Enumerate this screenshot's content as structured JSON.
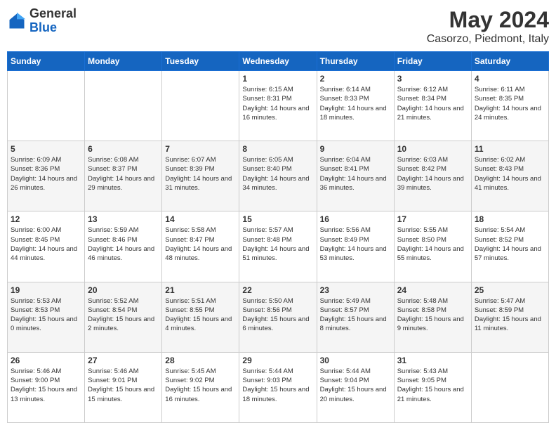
{
  "logo": {
    "general": "General",
    "blue": "Blue"
  },
  "header": {
    "month_year": "May 2024",
    "location": "Casorzo, Piedmont, Italy"
  },
  "weekdays": [
    "Sunday",
    "Monday",
    "Tuesday",
    "Wednesday",
    "Thursday",
    "Friday",
    "Saturday"
  ],
  "weeks": [
    [
      {
        "day": "",
        "sunrise": "",
        "sunset": "",
        "daylight": ""
      },
      {
        "day": "",
        "sunrise": "",
        "sunset": "",
        "daylight": ""
      },
      {
        "day": "",
        "sunrise": "",
        "sunset": "",
        "daylight": ""
      },
      {
        "day": "1",
        "sunrise": "Sunrise: 6:15 AM",
        "sunset": "Sunset: 8:31 PM",
        "daylight": "Daylight: 14 hours and 16 minutes."
      },
      {
        "day": "2",
        "sunrise": "Sunrise: 6:14 AM",
        "sunset": "Sunset: 8:33 PM",
        "daylight": "Daylight: 14 hours and 18 minutes."
      },
      {
        "day": "3",
        "sunrise": "Sunrise: 6:12 AM",
        "sunset": "Sunset: 8:34 PM",
        "daylight": "Daylight: 14 hours and 21 minutes."
      },
      {
        "day": "4",
        "sunrise": "Sunrise: 6:11 AM",
        "sunset": "Sunset: 8:35 PM",
        "daylight": "Daylight: 14 hours and 24 minutes."
      }
    ],
    [
      {
        "day": "5",
        "sunrise": "Sunrise: 6:09 AM",
        "sunset": "Sunset: 8:36 PM",
        "daylight": "Daylight: 14 hours and 26 minutes."
      },
      {
        "day": "6",
        "sunrise": "Sunrise: 6:08 AM",
        "sunset": "Sunset: 8:37 PM",
        "daylight": "Daylight: 14 hours and 29 minutes."
      },
      {
        "day": "7",
        "sunrise": "Sunrise: 6:07 AM",
        "sunset": "Sunset: 8:39 PM",
        "daylight": "Daylight: 14 hours and 31 minutes."
      },
      {
        "day": "8",
        "sunrise": "Sunrise: 6:05 AM",
        "sunset": "Sunset: 8:40 PM",
        "daylight": "Daylight: 14 hours and 34 minutes."
      },
      {
        "day": "9",
        "sunrise": "Sunrise: 6:04 AM",
        "sunset": "Sunset: 8:41 PM",
        "daylight": "Daylight: 14 hours and 36 minutes."
      },
      {
        "day": "10",
        "sunrise": "Sunrise: 6:03 AM",
        "sunset": "Sunset: 8:42 PM",
        "daylight": "Daylight: 14 hours and 39 minutes."
      },
      {
        "day": "11",
        "sunrise": "Sunrise: 6:02 AM",
        "sunset": "Sunset: 8:43 PM",
        "daylight": "Daylight: 14 hours and 41 minutes."
      }
    ],
    [
      {
        "day": "12",
        "sunrise": "Sunrise: 6:00 AM",
        "sunset": "Sunset: 8:45 PM",
        "daylight": "Daylight: 14 hours and 44 minutes."
      },
      {
        "day": "13",
        "sunrise": "Sunrise: 5:59 AM",
        "sunset": "Sunset: 8:46 PM",
        "daylight": "Daylight: 14 hours and 46 minutes."
      },
      {
        "day": "14",
        "sunrise": "Sunrise: 5:58 AM",
        "sunset": "Sunset: 8:47 PM",
        "daylight": "Daylight: 14 hours and 48 minutes."
      },
      {
        "day": "15",
        "sunrise": "Sunrise: 5:57 AM",
        "sunset": "Sunset: 8:48 PM",
        "daylight": "Daylight: 14 hours and 51 minutes."
      },
      {
        "day": "16",
        "sunrise": "Sunrise: 5:56 AM",
        "sunset": "Sunset: 8:49 PM",
        "daylight": "Daylight: 14 hours and 53 minutes."
      },
      {
        "day": "17",
        "sunrise": "Sunrise: 5:55 AM",
        "sunset": "Sunset: 8:50 PM",
        "daylight": "Daylight: 14 hours and 55 minutes."
      },
      {
        "day": "18",
        "sunrise": "Sunrise: 5:54 AM",
        "sunset": "Sunset: 8:52 PM",
        "daylight": "Daylight: 14 hours and 57 minutes."
      }
    ],
    [
      {
        "day": "19",
        "sunrise": "Sunrise: 5:53 AM",
        "sunset": "Sunset: 8:53 PM",
        "daylight": "Daylight: 15 hours and 0 minutes."
      },
      {
        "day": "20",
        "sunrise": "Sunrise: 5:52 AM",
        "sunset": "Sunset: 8:54 PM",
        "daylight": "Daylight: 15 hours and 2 minutes."
      },
      {
        "day": "21",
        "sunrise": "Sunrise: 5:51 AM",
        "sunset": "Sunset: 8:55 PM",
        "daylight": "Daylight: 15 hours and 4 minutes."
      },
      {
        "day": "22",
        "sunrise": "Sunrise: 5:50 AM",
        "sunset": "Sunset: 8:56 PM",
        "daylight": "Daylight: 15 hours and 6 minutes."
      },
      {
        "day": "23",
        "sunrise": "Sunrise: 5:49 AM",
        "sunset": "Sunset: 8:57 PM",
        "daylight": "Daylight: 15 hours and 8 minutes."
      },
      {
        "day": "24",
        "sunrise": "Sunrise: 5:48 AM",
        "sunset": "Sunset: 8:58 PM",
        "daylight": "Daylight: 15 hours and 9 minutes."
      },
      {
        "day": "25",
        "sunrise": "Sunrise: 5:47 AM",
        "sunset": "Sunset: 8:59 PM",
        "daylight": "Daylight: 15 hours and 11 minutes."
      }
    ],
    [
      {
        "day": "26",
        "sunrise": "Sunrise: 5:46 AM",
        "sunset": "Sunset: 9:00 PM",
        "daylight": "Daylight: 15 hours and 13 minutes."
      },
      {
        "day": "27",
        "sunrise": "Sunrise: 5:46 AM",
        "sunset": "Sunset: 9:01 PM",
        "daylight": "Daylight: 15 hours and 15 minutes."
      },
      {
        "day": "28",
        "sunrise": "Sunrise: 5:45 AM",
        "sunset": "Sunset: 9:02 PM",
        "daylight": "Daylight: 15 hours and 16 minutes."
      },
      {
        "day": "29",
        "sunrise": "Sunrise: 5:44 AM",
        "sunset": "Sunset: 9:03 PM",
        "daylight": "Daylight: 15 hours and 18 minutes."
      },
      {
        "day": "30",
        "sunrise": "Sunrise: 5:44 AM",
        "sunset": "Sunset: 9:04 PM",
        "daylight": "Daylight: 15 hours and 20 minutes."
      },
      {
        "day": "31",
        "sunrise": "Sunrise: 5:43 AM",
        "sunset": "Sunset: 9:05 PM",
        "daylight": "Daylight: 15 hours and 21 minutes."
      },
      {
        "day": "",
        "sunrise": "",
        "sunset": "",
        "daylight": ""
      }
    ]
  ]
}
